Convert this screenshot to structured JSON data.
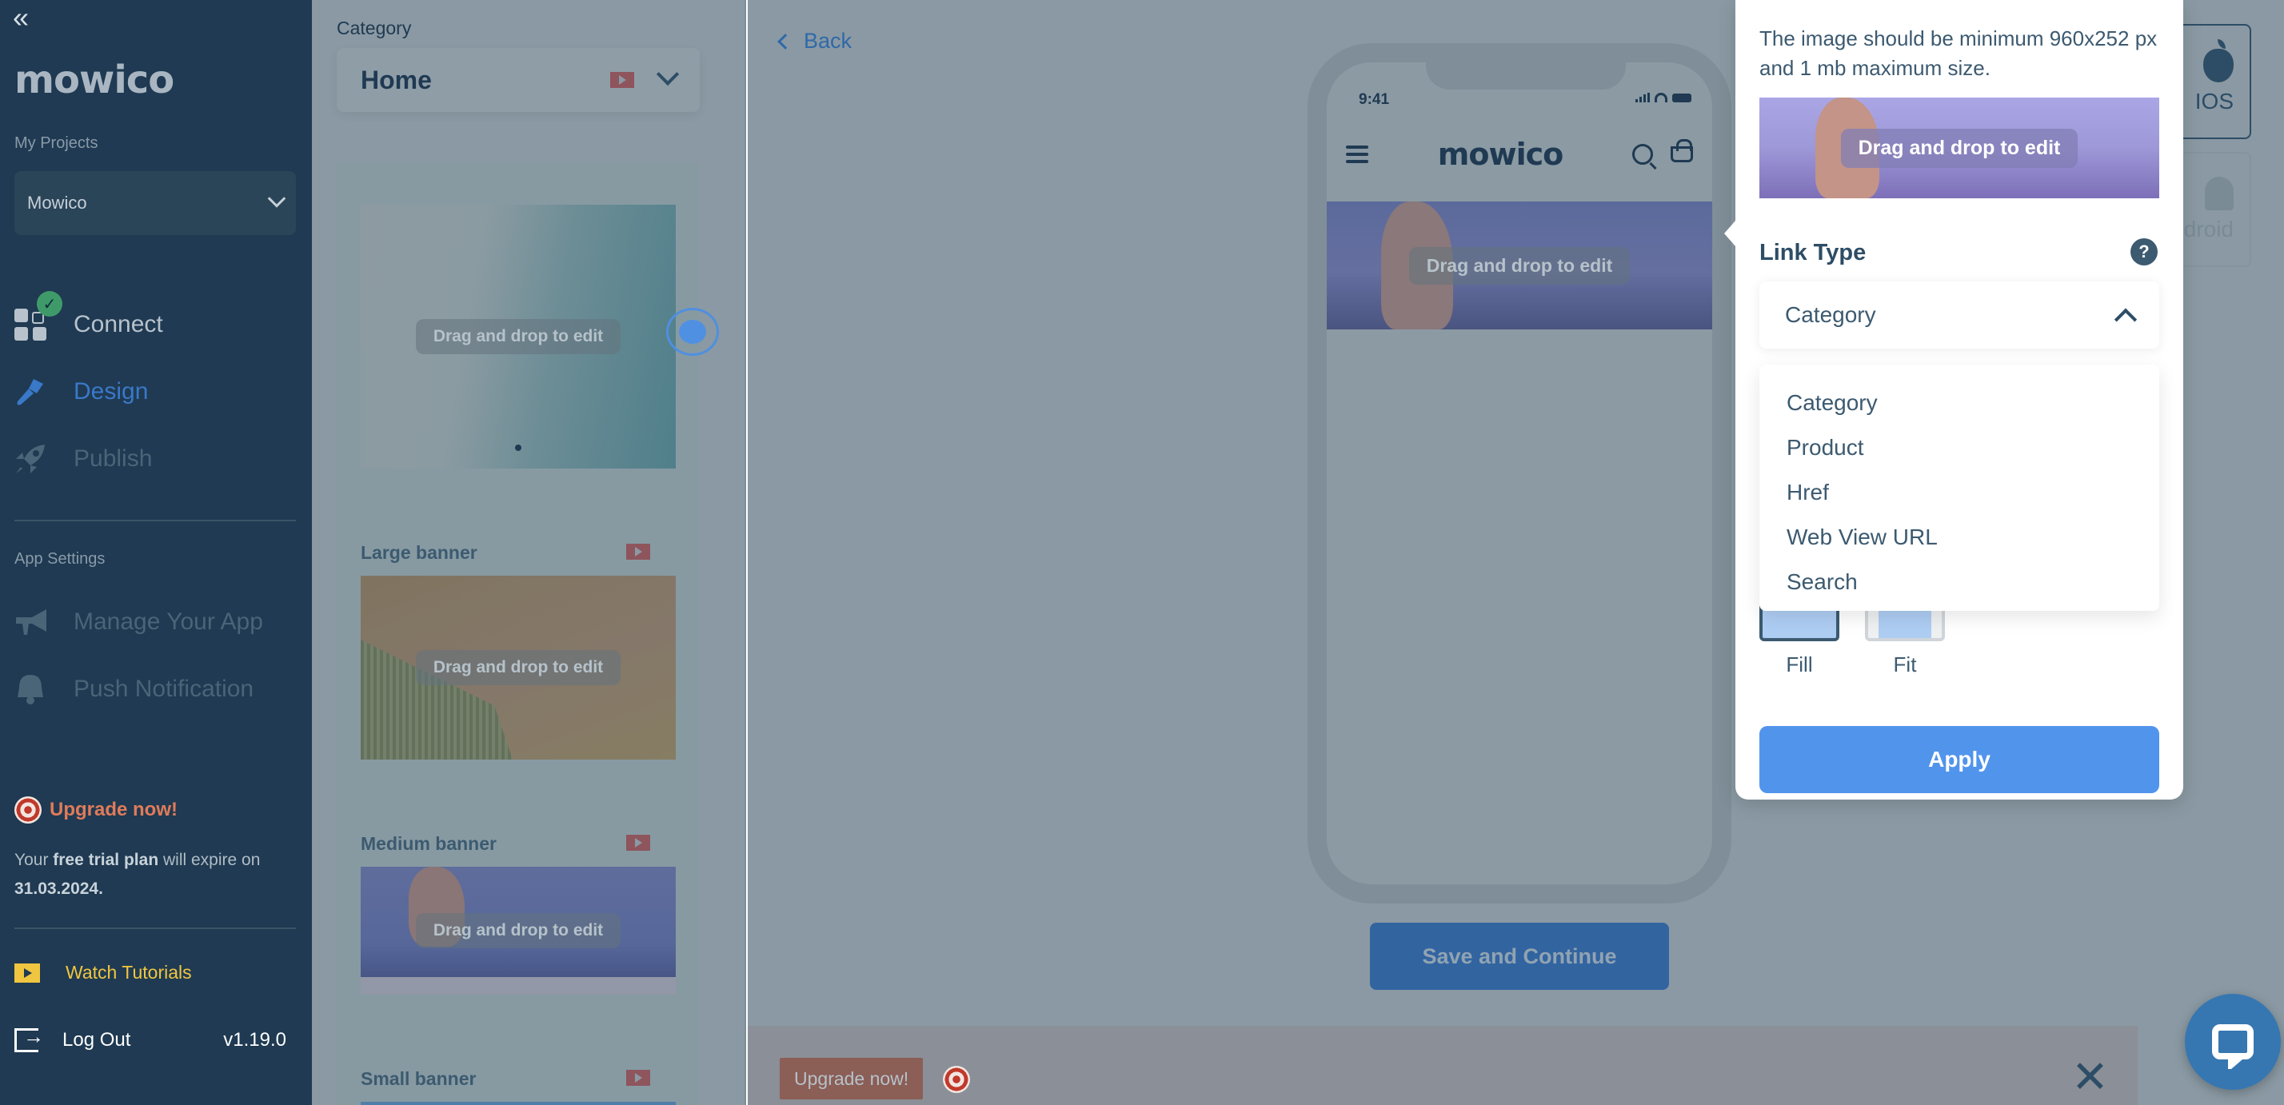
{
  "sidebar": {
    "collapse_icon": "«",
    "brand": "mowico",
    "projects_label": "My Projects",
    "project_selected": "Mowico",
    "nav": [
      {
        "label": "Connect",
        "icon": "grid-icon",
        "state": "completed"
      },
      {
        "label": "Design",
        "icon": "paintbrush-icon",
        "state": "active"
      },
      {
        "label": "Publish",
        "icon": "rocket-icon",
        "state": "disabled"
      }
    ],
    "app_settings_label": "App Settings",
    "settings_nav": [
      {
        "label": "Manage Your App",
        "icon": "megaphone-icon"
      },
      {
        "label": "Push Notification",
        "icon": "bell-icon"
      }
    ],
    "upgrade_label": "Upgrade now!",
    "trial_prefix": "Your ",
    "trial_bold": "free trial plan",
    "trial_suffix": " will expire on",
    "trial_date": "31.03.2024.",
    "tutorials_label": "Watch Tutorials",
    "logout_label": "Log Out",
    "version": "v1.19.0",
    "colors": {
      "bg": "#1f3a52",
      "active": "#3a78c8",
      "upgrade": "#e07b5a",
      "tutorials": "#f0c640"
    }
  },
  "category_panel": {
    "label": "Category",
    "selected": "Home",
    "components": [
      {
        "title": "",
        "type": "slider",
        "drag_label": "Drag and drop to edit"
      },
      {
        "title": "Large banner",
        "drag_label": "Drag and drop to edit"
      },
      {
        "title": "Medium banner",
        "drag_label": "Drag and drop to edit"
      },
      {
        "title": "Small banner",
        "drag_label": ""
      }
    ]
  },
  "main": {
    "back_label": "Back",
    "phone": {
      "time": "9:41",
      "logo": "mowico",
      "banner_drag_label": "Drag and drop to edit"
    },
    "save_button": "Save and Continue",
    "platforms": [
      {
        "label": "IOS",
        "icon": "apple-icon",
        "selected": true
      },
      {
        "label": "Android",
        "icon": "android-icon",
        "selected": false
      }
    ],
    "upgrade_bar": {
      "button": "Upgrade now!",
      "close": "✕"
    }
  },
  "popover": {
    "hint": "The image should be minimum 960x252 px and 1 mb maximum size.",
    "preview_drag_label": "Drag and drop to edit",
    "link_type_label": "Link Type",
    "help": "?",
    "link_type_selected": "Category",
    "link_type_options": [
      "Category",
      "Product",
      "Href",
      "Web View URL",
      "Search"
    ],
    "fit_options": [
      {
        "label": "Fill",
        "selected": true
      },
      {
        "label": "Fit",
        "selected": false
      }
    ],
    "apply_label": "Apply",
    "accent": "#5194ec"
  }
}
